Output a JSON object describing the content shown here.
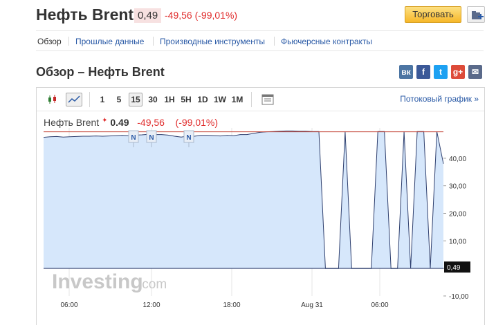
{
  "header": {
    "title": "Нефть Brent",
    "price": "0,49",
    "change": "-49,56",
    "change_pct": "(-99,01%)",
    "trade_label": "Торговать"
  },
  "subnav": {
    "items": [
      "Обзор",
      "Прошлые данные",
      "Производные инструменты",
      "Фьючерсные контракты"
    ]
  },
  "section": {
    "title": "Обзор – Нефть Brent",
    "social": [
      "vk-icon",
      "facebook-icon",
      "twitter-icon",
      "google-plus-icon",
      "email-icon"
    ],
    "social_labels": [
      "вк",
      "f",
      "t",
      "g+",
      "✉"
    ]
  },
  "toolbar": {
    "intervals": [
      "1",
      "5",
      "15",
      "30",
      "1H",
      "5H",
      "1D",
      "1W",
      "1M"
    ],
    "selected": "15",
    "stream_link": "Потоковый график »"
  },
  "legend": {
    "name": "Нефть Brent",
    "price": "0.49",
    "change": "-49,56",
    "change_pct": "(-99,01%)"
  },
  "news_marker": "N",
  "last_label": "0,49",
  "watermark": {
    "bold": "Investing",
    "light": ".com"
  },
  "colors": {
    "line": "#2e3f6e",
    "fill": "#d6e7fb",
    "ref": "#c0392b",
    "neg": "#e02b2b",
    "link": "#2a5aa6"
  },
  "chart_data": {
    "type": "area",
    "x_ticks": [
      "06:00",
      "12:00",
      "18:00",
      "Aug 31",
      "06:00"
    ],
    "y_ticks": [
      "40,00",
      "30,00",
      "20,00",
      "10,00",
      "0,00",
      "-10,00"
    ],
    "ylim": [
      -10,
      50
    ],
    "reference_line": 49.6,
    "series": [
      {
        "values": [
          47.6,
          47.8,
          47.9,
          47.7,
          47.8,
          47.9,
          48.0,
          48.0,
          48.1,
          48.0,
          48.1,
          48.2,
          48.3,
          48.2,
          48.4,
          48.5,
          48.7,
          48.6,
          48.6,
          48.4,
          48.0,
          47.7,
          48.1,
          48.0,
          48.3,
          48.3,
          48.2,
          48.1,
          48.3,
          48.2,
          48.6,
          48.6,
          49.0,
          49.4,
          49.6,
          49.7,
          49.8,
          49.9,
          49.9,
          49.8,
          49.8,
          49.7,
          49.7,
          0.0,
          0.0,
          0.0,
          49.7,
          0.0,
          0.0,
          0.0,
          0.0,
          49.7,
          49.7,
          0.0,
          0.0,
          49.7,
          0.0,
          49.7,
          49.7,
          0.0,
          49.7,
          38.0
        ]
      }
    ]
  }
}
